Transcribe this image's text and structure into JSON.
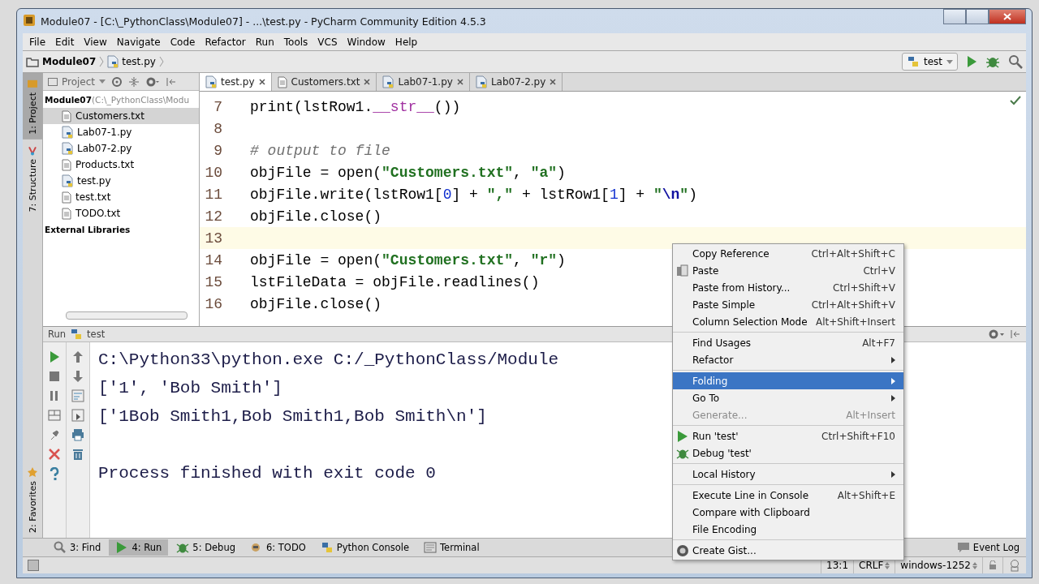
{
  "window": {
    "title": "Module07 - [C:\\_PythonClass\\Module07] - ...\\test.py - PyCharm Community Edition 4.5.3"
  },
  "menu_bar": [
    "File",
    "Edit",
    "View",
    "Navigate",
    "Code",
    "Refactor",
    "Run",
    "Tools",
    "VCS",
    "Window",
    "Help"
  ],
  "breadcrumb": [
    {
      "label": "Module07",
      "kind": "folder"
    },
    {
      "label": "test.py",
      "kind": "py"
    }
  ],
  "run_config": {
    "label": "test"
  },
  "side_stripe": {
    "top": [
      {
        "label": "1: Project",
        "kind": "project",
        "selected": true
      },
      {
        "label": "7: Structure",
        "kind": "structure",
        "selected": false
      }
    ],
    "bottom": [
      {
        "label": "2: Favorites",
        "kind": "favorites",
        "selected": false
      }
    ]
  },
  "project_panel": {
    "title": "Project",
    "tree": [
      {
        "label": "Module07",
        "note": "(C:\\_PythonClass\\Modu",
        "children": [
          {
            "label": "Customers.txt",
            "kind": "txt",
            "selected": true
          },
          {
            "label": "Lab07-1.py",
            "kind": "py",
            "selected": false
          },
          {
            "label": "Lab07-2.py",
            "kind": "py",
            "selected": false
          },
          {
            "label": "Products.txt",
            "kind": "txt",
            "selected": false
          },
          {
            "label": "test.py",
            "kind": "py",
            "selected": false
          },
          {
            "label": "test.txt",
            "kind": "txt",
            "selected": false
          },
          {
            "label": "TODO.txt",
            "kind": "txt",
            "selected": false
          }
        ]
      },
      {
        "label": "External Libraries"
      }
    ]
  },
  "editor_tabs": [
    {
      "label": "test.py",
      "kind": "py",
      "selected": true
    },
    {
      "label": "Customers.txt",
      "kind": "txt",
      "selected": false
    },
    {
      "label": "Lab07-1.py",
      "kind": "py",
      "selected": false
    },
    {
      "label": "Lab07-2.py",
      "kind": "py",
      "selected": false
    }
  ],
  "code": [
    {
      "number": "7",
      "current": false,
      "tokens": [
        {
          "kind": "plain",
          "t": "print(lstRow1."
        },
        {
          "kind": "magic",
          "t": "__str__"
        },
        {
          "kind": "plain",
          "t": "())"
        }
      ]
    },
    {
      "number": "8",
      "current": false
    },
    {
      "number": "9",
      "current": false,
      "tokens": [
        {
          "kind": "comment",
          "t": "# output to file"
        }
      ]
    },
    {
      "number": "10",
      "current": false,
      "tokens": [
        {
          "kind": "plain",
          "t": "objFile = open("
        },
        {
          "kind": "string",
          "t": "\"Customers.txt\""
        },
        {
          "kind": "plain",
          "t": ", "
        },
        {
          "kind": "string",
          "t": "\"a\""
        },
        {
          "kind": "plain",
          "t": ")"
        }
      ]
    },
    {
      "number": "11",
      "current": false,
      "tokens": [
        {
          "kind": "plain",
          "t": "objFile.write(lstRow1["
        },
        {
          "kind": "number",
          "t": "0"
        },
        {
          "kind": "plain",
          "t": "] + "
        },
        {
          "kind": "string",
          "t": "\",\""
        },
        {
          "kind": "plain",
          "t": " + lstRow1["
        },
        {
          "kind": "number",
          "t": "1"
        },
        {
          "kind": "plain",
          "t": "] + "
        },
        {
          "kind": "string",
          "t": "\""
        },
        {
          "kind": "escape",
          "t": "\\n"
        },
        {
          "kind": "string",
          "t": "\""
        },
        {
          "kind": "plain",
          "t": ")"
        }
      ]
    },
    {
      "number": "12",
      "current": false,
      "tokens": [
        {
          "kind": "plain",
          "t": "objFile.close()"
        }
      ]
    },
    {
      "number": "13",
      "current": true
    },
    {
      "number": "14",
      "current": false,
      "tokens": [
        {
          "kind": "plain",
          "t": "objFile = open("
        },
        {
          "kind": "string",
          "t": "\"Customers.txt\""
        },
        {
          "kind": "plain",
          "t": ", "
        },
        {
          "kind": "string",
          "t": "\"r\""
        },
        {
          "kind": "plain",
          "t": ")"
        }
      ]
    },
    {
      "number": "15",
      "current": false,
      "tokens": [
        {
          "kind": "plain",
          "t": "lstFileData = objFile.readlines()"
        }
      ]
    },
    {
      "number": "16",
      "current": false,
      "tokens": [
        {
          "kind": "plain",
          "t": "objFile.close()"
        }
      ]
    }
  ],
  "run_panel": {
    "title": "Run",
    "config": "test",
    "output": [
      {
        "text": "C:\\Python33\\python.exe C:/_PythonClass/Module",
        "gap_before": false
      },
      {
        "text": "['1', 'Bob Smith']",
        "gap_before": false
      },
      {
        "text": "['1Bob Smith1,Bob Smith1,Bob Smith\\n']",
        "gap_before": false
      },
      {
        "text": "Process finished with exit code 0",
        "gap_before": true
      }
    ]
  },
  "context_menu": {
    "groups": [
      [
        {
          "label": "Copy Reference",
          "shortcut": "Ctrl+Alt+Shift+C"
        },
        {
          "label": "Paste",
          "shortcut": "Ctrl+V",
          "kind": "paste"
        },
        {
          "label": "Paste from History...",
          "shortcut": "Ctrl+Shift+V"
        },
        {
          "label": "Paste Simple",
          "shortcut": "Ctrl+Alt+Shift+V"
        },
        {
          "label": "Column Selection Mode",
          "shortcut": "Alt+Shift+Insert"
        }
      ],
      [
        {
          "label": "Find Usages",
          "shortcut": "Alt+F7"
        },
        {
          "label": "Refactor",
          "submenu": true
        }
      ],
      [
        {
          "label": "Folding",
          "submenu": true,
          "selected": true
        },
        {
          "label": "Go To",
          "submenu": true
        },
        {
          "label": "Generate...",
          "shortcut": "Alt+Insert",
          "disabled": true
        }
      ],
      [
        {
          "label": "Run 'test'",
          "shortcut": "Ctrl+Shift+F10",
          "kind": "run"
        },
        {
          "label": "Debug 'test'",
          "kind": "debug"
        }
      ],
      [
        {
          "label": "Local History",
          "submenu": true
        }
      ],
      [
        {
          "label": "Execute Line in Console",
          "shortcut": "Alt+Shift+E"
        },
        {
          "label": "Compare with Clipboard"
        },
        {
          "label": "File Encoding"
        }
      ],
      [
        {
          "label": "Create Gist...",
          "kind": "gist"
        }
      ]
    ]
  },
  "tool_tabs": [
    {
      "label": "3: Find",
      "kind": "find",
      "selected": false
    },
    {
      "label": "4: Run",
      "kind": "run",
      "selected": true
    },
    {
      "label": "5: Debug",
      "kind": "debug",
      "selected": false
    },
    {
      "label": "6: TODO",
      "kind": "todo",
      "selected": false
    },
    {
      "label": "Python Console",
      "kind": "console",
      "selected": false
    },
    {
      "label": "Terminal",
      "kind": "terminal",
      "selected": false
    }
  ],
  "event_log": "Event Log",
  "status_bar": {
    "position": "13:1",
    "line_separator": "CRLF",
    "encoding": "windows-1252"
  }
}
